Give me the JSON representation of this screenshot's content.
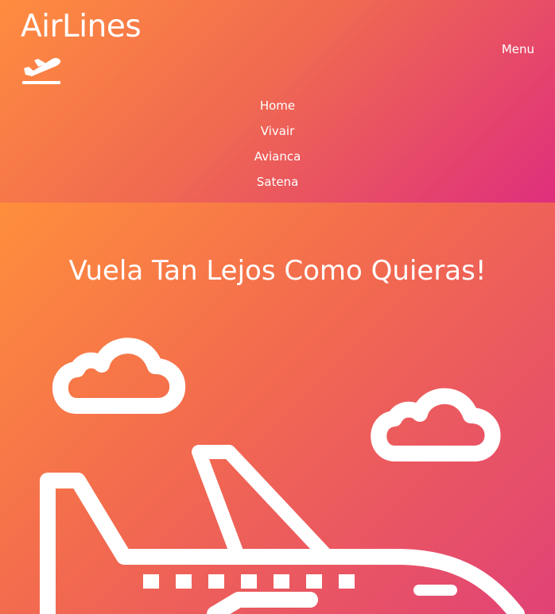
{
  "header": {
    "brand": "AirLines",
    "brand_icon": "plane-takeoff-icon",
    "menu_label": "Menu"
  },
  "nav": {
    "items": [
      {
        "label": "Home"
      },
      {
        "label": "Vivair"
      },
      {
        "label": "Avianca"
      },
      {
        "label": "Satena"
      }
    ]
  },
  "hero": {
    "title": "Vuela Tan Lejos Como Quieras!",
    "illustration": "airplane-and-clouds-icon"
  },
  "colors": {
    "gradient_start": "#ff8c3f",
    "gradient_mid": "#f06a50",
    "gradient_end": "#df2f7d",
    "text": "#ffffff"
  }
}
